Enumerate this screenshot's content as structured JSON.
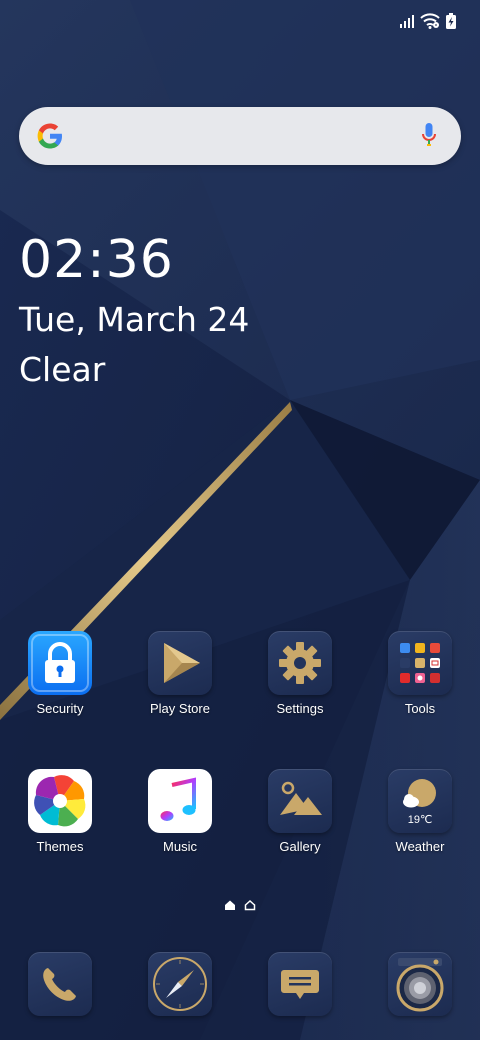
{
  "status_bar": {
    "signal_icon": "signal-bars-icon",
    "wifi_icon": "wifi-icon",
    "battery_icon": "battery-charging-icon"
  },
  "search": {
    "logo_icon": "google-g-icon",
    "mic_icon": "microphone-icon"
  },
  "clock_widget": {
    "time": "02:36",
    "date": "Tue, March 24",
    "weather": "Clear"
  },
  "apps": [
    {
      "label": "Security",
      "icon": "lock-icon"
    },
    {
      "label": "Play Store",
      "icon": "play-store-icon"
    },
    {
      "label": "Settings",
      "icon": "gear-icon"
    },
    {
      "label": "Tools",
      "icon": "folder-grid-icon"
    },
    {
      "label": "Themes",
      "icon": "themes-pinwheel-icon"
    },
    {
      "label": "Music",
      "icon": "music-note-icon"
    },
    {
      "label": "Gallery",
      "icon": "mountain-image-icon"
    },
    {
      "label": "Weather",
      "icon": "sun-cloud-icon",
      "temp": "19℃"
    }
  ],
  "pager": {
    "current_page": 1,
    "pages": [
      "page-dot",
      "home"
    ]
  },
  "dock": [
    {
      "name": "phone",
      "icon": "phone-handset-icon"
    },
    {
      "name": "browser",
      "icon": "compass-icon"
    },
    {
      "name": "messages",
      "icon": "message-bubble-icon"
    },
    {
      "name": "camera",
      "icon": "camera-lens-icon"
    }
  ],
  "colors": {
    "wallpaper_dark": "#13203f",
    "wallpaper_light": "#22335c",
    "gold_accent": "#c9a86a",
    "search_bg": "#e7e8ec"
  }
}
